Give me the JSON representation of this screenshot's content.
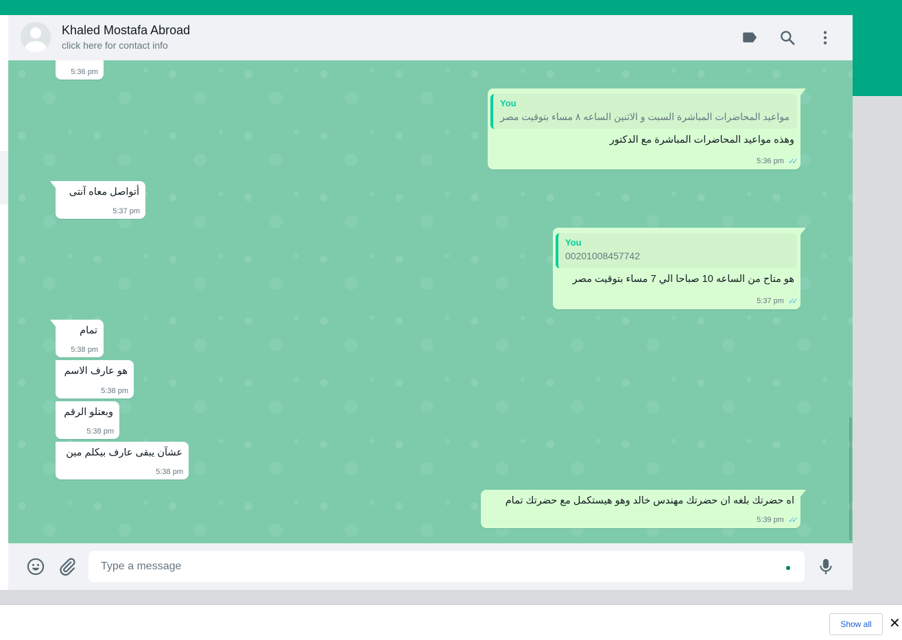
{
  "header": {
    "name": "Khaled Mostafa Abroad",
    "subtitle": "click here for contact info",
    "icons": [
      "label-icon",
      "search-icon",
      "menu-icon"
    ]
  },
  "messages": [
    {
      "dir": "in",
      "text": "",
      "time": "5:36 pm"
    },
    {
      "dir": "out",
      "quote_author": "You",
      "quote_text": "مواعيد المحاضرات المباشرة السبت و الاثنين الساعه ٨ مساء بتوقيت مصر",
      "text": "وهذه مواعيد المحاضرات المباشرة مع الدكتور",
      "time": "5:36 pm",
      "status": "read"
    },
    {
      "dir": "in",
      "text": "أتواصل معاه آنتى",
      "time": "5:37 pm"
    },
    {
      "dir": "out",
      "quote_author": "You",
      "quote_text": "00201008457742",
      "text": "هو متاح من الساعه 10 صباحا الي 7 مساء بتوقيت مصر",
      "time": "5:37 pm",
      "status": "read"
    },
    {
      "dir": "in",
      "text": "تمام",
      "time": "5:38 pm"
    },
    {
      "dir": "in",
      "text": "هو عارف الاسم",
      "time": "5:38 pm"
    },
    {
      "dir": "in",
      "text": "وبعتلو الرقم",
      "time": "5:38 pm"
    },
    {
      "dir": "in",
      "text": "عشآن يبقى عارف بيكلم مين",
      "time": "5:38 pm"
    },
    {
      "dir": "out",
      "text": "اه حضرتك بلغه ان حضرتك مهندس خالد وهو هيستكمل مع حضرتك تمام",
      "time": "5:39 pm",
      "status": "read"
    }
  ],
  "footer": {
    "placeholder": "Type a message",
    "icons": [
      "emoji-icon",
      "attach-icon",
      "mic-icon"
    ]
  },
  "downloads_bar": {
    "show_all": "Show all",
    "close": "✕"
  },
  "colors": {
    "accent": "#00a884",
    "chat_bg": "#7dcbab",
    "outgoing_bubble": "#d9fdd3",
    "incoming_bubble": "#ffffff",
    "read_ticks": "#53bdeb"
  }
}
